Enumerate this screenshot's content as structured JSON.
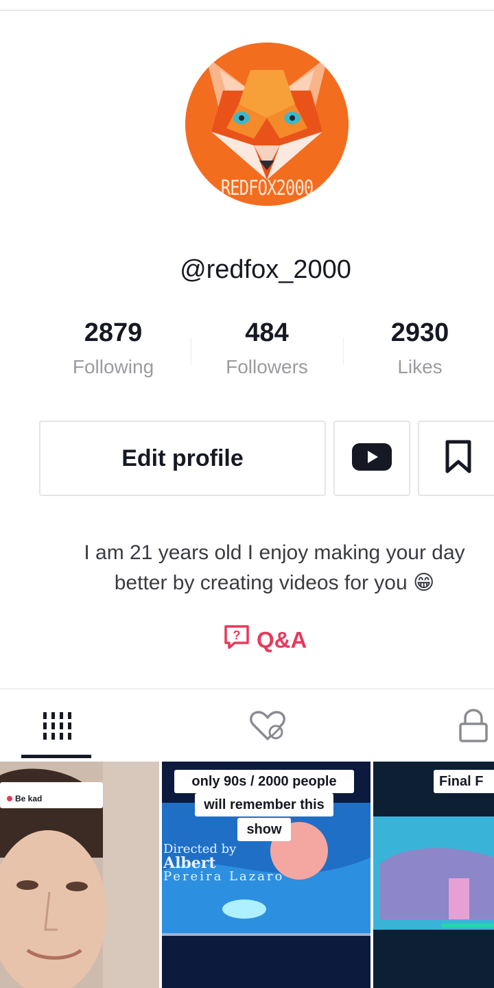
{
  "profile": {
    "avatar_caption": "REDFOX2000",
    "username": "@redfox_2000",
    "bio_line1": "I am 21 years old I enjoy making your  day",
    "bio_line2": "better by  creating videos for you 😁",
    "qa_label": "Q&A"
  },
  "stats": [
    {
      "value": "2879",
      "label": "Following"
    },
    {
      "value": "484",
      "label": "Followers"
    },
    {
      "value": "2930",
      "label": "Likes"
    }
  ],
  "actions": {
    "edit_profile": "Edit profile",
    "youtube_icon": "youtube-icon",
    "bookmark_icon": "bookmark-icon"
  },
  "tabs": [
    {
      "icon": "grid-icon",
      "active": true
    },
    {
      "icon": "liked-hidden-icon",
      "active": false
    },
    {
      "icon": "lock-icon",
      "active": false
    }
  ],
  "videos": [
    {
      "caption": "Be kad"
    },
    {
      "caption_line1": "only 90s / 2000 people",
      "caption_line2": "will remember this",
      "caption_line3": "show",
      "overlay_line1": "Directed by",
      "overlay_line2": "Albert",
      "overlay_line3": "Pereira Lazaro"
    },
    {
      "caption": "Final F"
    }
  ],
  "colors": {
    "accent": "#e8395a",
    "avatar_bg": "#f36d1f",
    "muted_text": "#9a9ba1",
    "primary_text": "#161823"
  }
}
